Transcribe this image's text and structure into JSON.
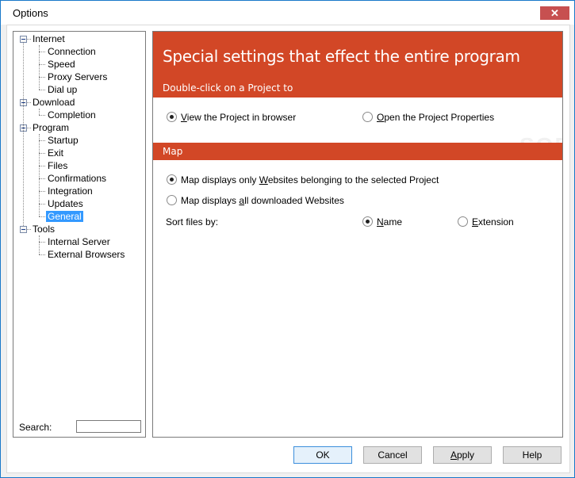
{
  "window": {
    "title": "Options",
    "close_icon": "close-icon"
  },
  "tree": {
    "nodes": [
      {
        "label": "Internet",
        "level": 0,
        "expanded": true
      },
      {
        "label": "Connection",
        "level": 1
      },
      {
        "label": "Speed",
        "level": 1
      },
      {
        "label": "Proxy Servers",
        "level": 1
      },
      {
        "label": "Dial up",
        "level": 1
      },
      {
        "label": "Download",
        "level": 0,
        "expanded": true
      },
      {
        "label": "Completion",
        "level": 1
      },
      {
        "label": "Program",
        "level": 0,
        "expanded": true
      },
      {
        "label": "Startup",
        "level": 1
      },
      {
        "label": "Exit",
        "level": 1
      },
      {
        "label": "Files",
        "level": 1
      },
      {
        "label": "Confirmations",
        "level": 1
      },
      {
        "label": "Integration",
        "level": 1
      },
      {
        "label": "Updates",
        "level": 1
      },
      {
        "label": "General",
        "level": 1,
        "selected": true
      },
      {
        "label": "Tools",
        "level": 0,
        "expanded": true
      },
      {
        "label": "Internal Server",
        "level": 1
      },
      {
        "label": "External Browsers",
        "level": 1
      }
    ],
    "search_label": "Search:",
    "search_value": ""
  },
  "main": {
    "header_title": "Special settings that effect the entire program",
    "double_click_section": {
      "title": "Double-click on a Project to",
      "options": [
        {
          "label": "View the Project in browser",
          "mnemonic": "V",
          "checked": true
        },
        {
          "label": "Open the Project Properties",
          "mnemonic": "O",
          "checked": false
        }
      ]
    },
    "map_section": {
      "title": "Map",
      "options": [
        {
          "pre": "Map displays only ",
          "mn": "W",
          "post": "ebsites belonging to the selected Project",
          "checked": true
        },
        {
          "pre": "Map displays ",
          "mn": "a",
          "post": "ll downloaded Websites",
          "checked": false
        }
      ],
      "sort_label": "Sort files by:",
      "sort_options": [
        {
          "mn": "N",
          "post": "ame",
          "checked": true
        },
        {
          "mn": "E",
          "post": "xtension",
          "checked": false
        }
      ]
    },
    "watermark": "SOFTPEDIA"
  },
  "buttons": {
    "ok": "OK",
    "cancel": "Cancel",
    "apply_mn": "A",
    "apply_post": "pply",
    "help": "Help"
  }
}
